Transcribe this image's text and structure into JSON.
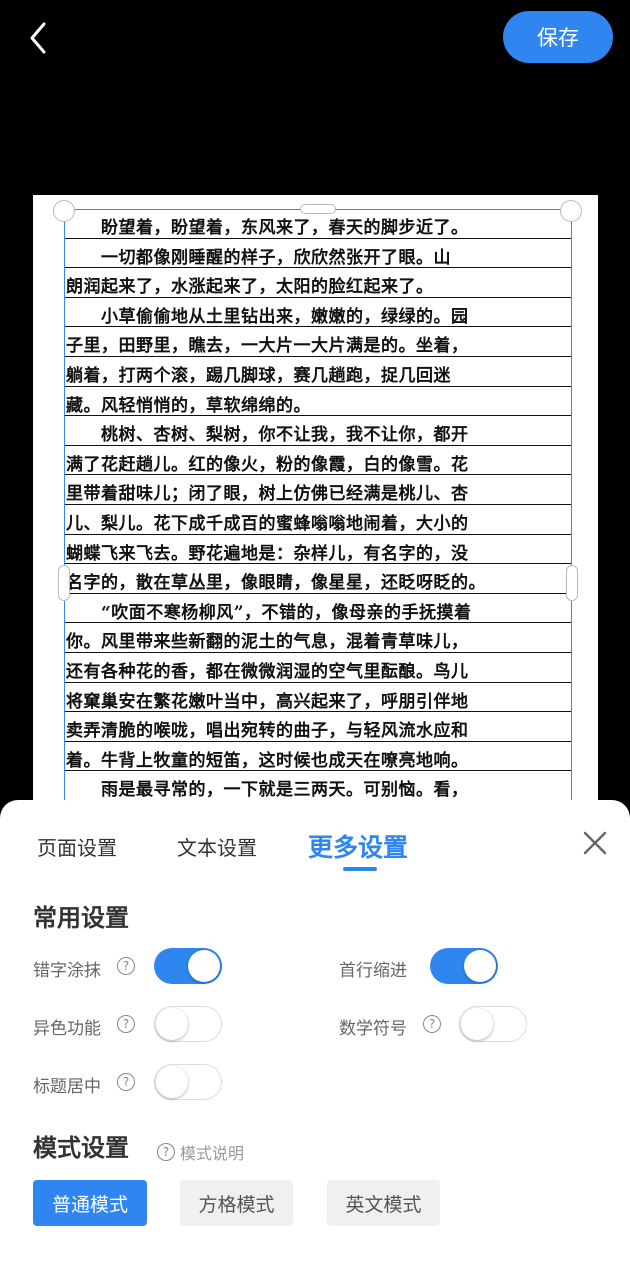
{
  "topbar": {
    "back_icon": "chevron-left-icon",
    "save_label": "保存"
  },
  "document": {
    "lines": [
      "　　盼望着，盼望着，东风来了，春天的脚步近了。",
      "　　一切都像刚睡醒的样子，欣欣然张开了眼。山",
      "朗润起来了，水涨起来了，太阳的脸红起来了。",
      "　　小草偷偷地从土里钻出来，嫩嫩的，绿绿的。园",
      "子里，田野里，瞧去，一大片一大片满是的。坐着，",
      "躺着，打两个滚，踢几脚球，赛几趟跑，捉几回迷",
      "藏。风轻悄悄的，草软绵绵的。",
      "　　桃树、杏树、梨树，你不让我，我不让你，都开",
      "满了花赶趟儿。红的像火，粉的像霞，白的像雪。花",
      "里带着甜味儿；闭了眼，树上仿佛已经满是桃儿、杏",
      "儿、梨儿。花下成千成百的蜜蜂嗡嗡地闹着，大小的",
      "蝴蝶飞来飞去。野花遍地是：杂样儿，有名字的，没",
      "名字的，散在草丛里，像眼睛，像星星，还眨呀眨的。",
      "　　“吹面不寒杨柳风”，不错的，像母亲的手抚摸着",
      "你。风里带来些新翻的泥土的气息，混着青草味儿，",
      "还有各种花的香，都在微微润湿的空气里酝酿。鸟儿",
      "将窠巢安在繁花嫩叶当中，高兴起来了，呼朋引伴地",
      "卖弄清脆的喉咙，唱出宛转的曲子，与轻风流水应和",
      "着。牛背上牧童的短笛，这时候也成天在嘹亮地响。",
      "　　雨是最寻常的，一下就是三两天。可别恼。看，"
    ]
  },
  "sheet": {
    "tabs": [
      {
        "label": "页面设置"
      },
      {
        "label": "文本设置"
      },
      {
        "label": "更多设置"
      }
    ],
    "active_tab": "更多设置",
    "close_icon": "close-icon",
    "common": {
      "title": "常用设置",
      "options": [
        {
          "label": "错字涂抹",
          "on": true
        },
        {
          "label": "首行缩进",
          "on": true
        },
        {
          "label": "异色功能",
          "on": false
        },
        {
          "label": "数学符号",
          "on": false
        },
        {
          "label": "标题居中",
          "on": false
        }
      ]
    },
    "mode": {
      "title": "模式设置",
      "help_label": "模式说明",
      "buttons": [
        {
          "label": "普通模式",
          "active": true
        },
        {
          "label": "方格模式",
          "active": false
        },
        {
          "label": "英文模式",
          "active": false
        }
      ]
    }
  },
  "colors": {
    "accent": "#2f86f0",
    "background": "#000000"
  }
}
